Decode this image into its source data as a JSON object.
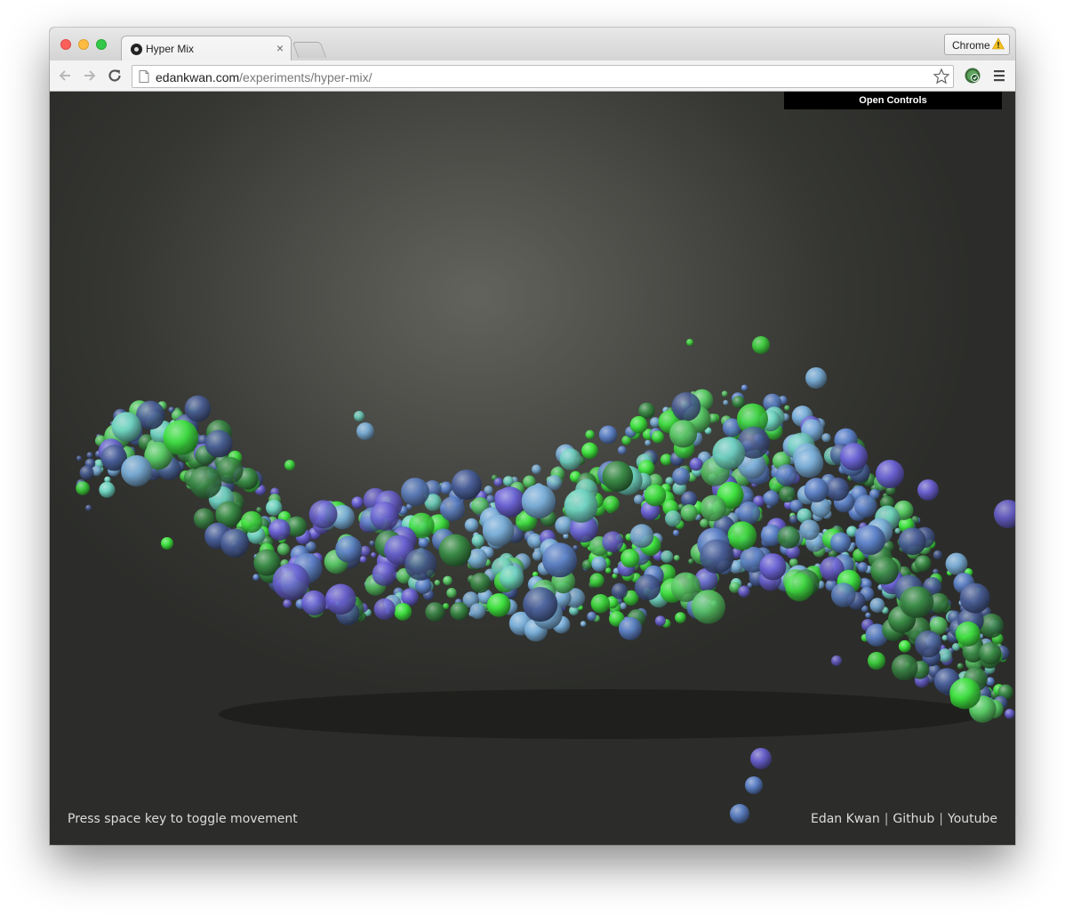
{
  "tab": {
    "title": "Hyper Mix",
    "close_glyph": "×"
  },
  "profile": {
    "label": "Chrome",
    "icon": "warning-icon"
  },
  "toolbar": {
    "url_host": "edankwan.com",
    "url_path": "/experiments/hyper-mix/"
  },
  "page": {
    "controls_label": "Open Controls",
    "hint": "Press space key to toggle movement",
    "links": [
      "Edan Kwan",
      "Github",
      "Youtube"
    ],
    "separator": "|"
  },
  "colors": {
    "background": "#3a3b37",
    "sphere_palette": [
      "#3fe23f",
      "#58c865",
      "#7aaed8",
      "#5d82c8",
      "#6b62d6",
      "#4a5f99",
      "#3a8a46",
      "#6fd3c0"
    ]
  }
}
